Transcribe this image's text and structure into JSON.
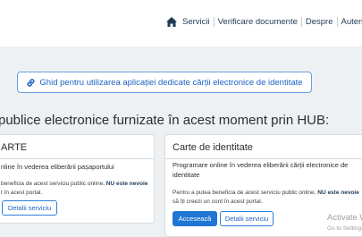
{
  "nav": {
    "home_icon": "home-icon",
    "items": [
      "Servicii",
      "Verificare documente",
      "Despre",
      "Autentif"
    ]
  },
  "guide": {
    "icon": "link-icon",
    "label": "Ghid pentru utilizarea aplicației dedicate cărții electronice de identitate"
  },
  "heading": "publice electronice furnizate în acest moment prin  HUB:",
  "cards": [
    {
      "title": "ARTE",
      "desc": "nline în vederea eliberării pașaportului",
      "note_prefix": "beneficia de acest serviciu public online, ",
      "note_bold": "NU este nevoie",
      "note_suffix": "t în acest portal.",
      "details_label": "Detalii serviciu"
    },
    {
      "title": "Carte de identitate",
      "desc": "Programare online în vederea eliberării cărții electronice de identitate",
      "note_prefix": "Pentru a putea beneficia de acest serviciu public online, ",
      "note_bold": "NU este nevoie",
      "note_suffix": "să îți creezi un cont în acest portal.",
      "access_label": "Accesează",
      "details_label": "Detalii serviciu"
    }
  ],
  "watermark": {
    "title": "Activate W",
    "subtitle": "Go to Settings"
  },
  "colors": {
    "accent": "#1f76d3",
    "nav_text": "#1f3b57",
    "background": "#eef1f3"
  }
}
